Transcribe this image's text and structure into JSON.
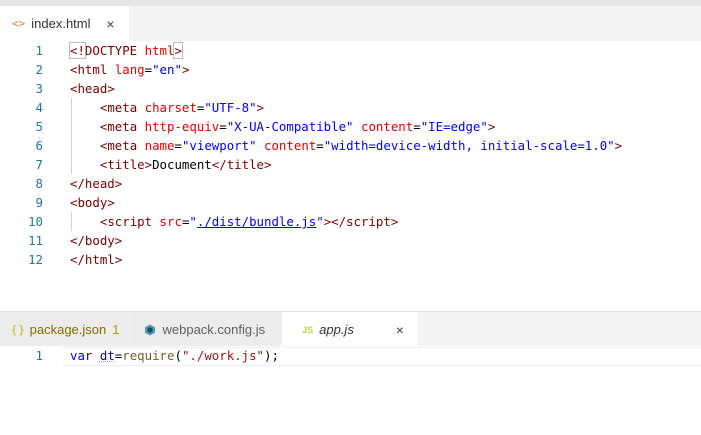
{
  "top_tab": {
    "icon": "html-file-icon",
    "label": "index.html",
    "close": "×"
  },
  "top_editor": {
    "line_numbers": [
      "1",
      "2",
      "3",
      "4",
      "5",
      "6",
      "7",
      "8",
      "9",
      "10",
      "11",
      "12"
    ],
    "lines": [
      [
        {
          "t": "<!",
          "c": "punc"
        },
        {
          "t": "DOCTYPE",
          "c": "punc"
        },
        {
          "t": " ",
          "c": "text"
        },
        {
          "t": "html",
          "c": "attr"
        },
        {
          "t": ">",
          "c": "punc"
        }
      ],
      [
        {
          "t": "<",
          "c": "punc"
        },
        {
          "t": "html",
          "c": "tag"
        },
        {
          "t": " ",
          "c": "text"
        },
        {
          "t": "lang",
          "c": "attr"
        },
        {
          "t": "=",
          "c": "eq"
        },
        {
          "t": "\"en\"",
          "c": "str"
        },
        {
          "t": ">",
          "c": "punc"
        }
      ],
      [
        {
          "t": "<",
          "c": "punc"
        },
        {
          "t": "head",
          "c": "tag"
        },
        {
          "t": ">",
          "c": "punc"
        }
      ],
      [
        {
          "t": "    ",
          "c": "text"
        },
        {
          "t": "<",
          "c": "punc"
        },
        {
          "t": "meta",
          "c": "tag"
        },
        {
          "t": " ",
          "c": "text"
        },
        {
          "t": "charset",
          "c": "attr"
        },
        {
          "t": "=",
          "c": "eq"
        },
        {
          "t": "\"UTF-8\"",
          "c": "str"
        },
        {
          "t": ">",
          "c": "punc"
        }
      ],
      [
        {
          "t": "    ",
          "c": "text"
        },
        {
          "t": "<",
          "c": "punc"
        },
        {
          "t": "meta",
          "c": "tag"
        },
        {
          "t": " ",
          "c": "text"
        },
        {
          "t": "http-equiv",
          "c": "attr"
        },
        {
          "t": "=",
          "c": "eq"
        },
        {
          "t": "\"X-UA-Compatible\"",
          "c": "str"
        },
        {
          "t": " ",
          "c": "text"
        },
        {
          "t": "content",
          "c": "attr"
        },
        {
          "t": "=",
          "c": "eq"
        },
        {
          "t": "\"IE=edge\"",
          "c": "str"
        },
        {
          "t": ">",
          "c": "punc"
        }
      ],
      [
        {
          "t": "    ",
          "c": "text"
        },
        {
          "t": "<",
          "c": "punc"
        },
        {
          "t": "meta",
          "c": "tag"
        },
        {
          "t": " ",
          "c": "text"
        },
        {
          "t": "name",
          "c": "attr"
        },
        {
          "t": "=",
          "c": "eq"
        },
        {
          "t": "\"viewport\"",
          "c": "str"
        },
        {
          "t": " ",
          "c": "text"
        },
        {
          "t": "content",
          "c": "attr"
        },
        {
          "t": "=",
          "c": "eq"
        },
        {
          "t": "\"width=device-width, initial-scale=1.0\"",
          "c": "str"
        },
        {
          "t": ">",
          "c": "punc"
        }
      ],
      [
        {
          "t": "    ",
          "c": "text"
        },
        {
          "t": "<",
          "c": "punc"
        },
        {
          "t": "title",
          "c": "tag"
        },
        {
          "t": ">",
          "c": "punc"
        },
        {
          "t": "Document",
          "c": "text"
        },
        {
          "t": "</",
          "c": "punc"
        },
        {
          "t": "title",
          "c": "tag"
        },
        {
          "t": ">",
          "c": "punc"
        }
      ],
      [
        {
          "t": "</",
          "c": "punc"
        },
        {
          "t": "head",
          "c": "tag"
        },
        {
          "t": ">",
          "c": "punc"
        }
      ],
      [
        {
          "t": "<",
          "c": "punc"
        },
        {
          "t": "body",
          "c": "tag"
        },
        {
          "t": ">",
          "c": "punc"
        }
      ],
      [
        {
          "t": "    ",
          "c": "text"
        },
        {
          "t": "<",
          "c": "punc"
        },
        {
          "t": "script",
          "c": "tag"
        },
        {
          "t": " ",
          "c": "text"
        },
        {
          "t": "src",
          "c": "attr"
        },
        {
          "t": "=",
          "c": "eq"
        },
        {
          "t": "\"",
          "c": "str"
        },
        {
          "t": "./dist/bundle.js",
          "c": "str",
          "link": true
        },
        {
          "t": "\"",
          "c": "str"
        },
        {
          "t": ">",
          "c": "punc"
        },
        {
          "t": "</",
          "c": "punc"
        },
        {
          "t": "script",
          "c": "tag"
        },
        {
          "t": ">",
          "c": "punc"
        }
      ],
      [
        {
          "t": "</",
          "c": "punc"
        },
        {
          "t": "body",
          "c": "tag"
        },
        {
          "t": ">",
          "c": "punc"
        }
      ],
      [
        {
          "t": "</",
          "c": "punc"
        },
        {
          "t": "html",
          "c": "tag"
        },
        {
          "t": ">",
          "c": "punc"
        }
      ]
    ]
  },
  "bottom_tabs": [
    {
      "icon": "json-braces-icon",
      "label": "package.json",
      "badge": "1",
      "active": false
    },
    {
      "icon": "webpack-icon",
      "label": "webpack.config.js",
      "badge": "",
      "active": false
    },
    {
      "icon": "js-file-icon",
      "icon_text": "JS",
      "label": "app.js",
      "badge": "",
      "active": true,
      "close": "×"
    }
  ],
  "bottom_editor": {
    "line_numbers": [
      "1"
    ],
    "lines": [
      [
        {
          "t": "var",
          "c": "kw"
        },
        {
          "t": " ",
          "c": "text"
        },
        {
          "t": "dt",
          "c": "var",
          "dots": true
        },
        {
          "t": "=",
          "c": "eq"
        },
        {
          "t": "require",
          "c": "fn"
        },
        {
          "t": "(",
          "c": "eq"
        },
        {
          "t": "\"./work.js\"",
          "c": "jstr"
        },
        {
          "t": ");",
          "c": "eq"
        }
      ]
    ]
  },
  "colors": {
    "line_number": "#237893",
    "tag": "#800000",
    "attribute": "#e50000",
    "string": "#0000ff",
    "keyword": "#0000ff",
    "js_string": "#a31515",
    "function": "#795e26"
  }
}
